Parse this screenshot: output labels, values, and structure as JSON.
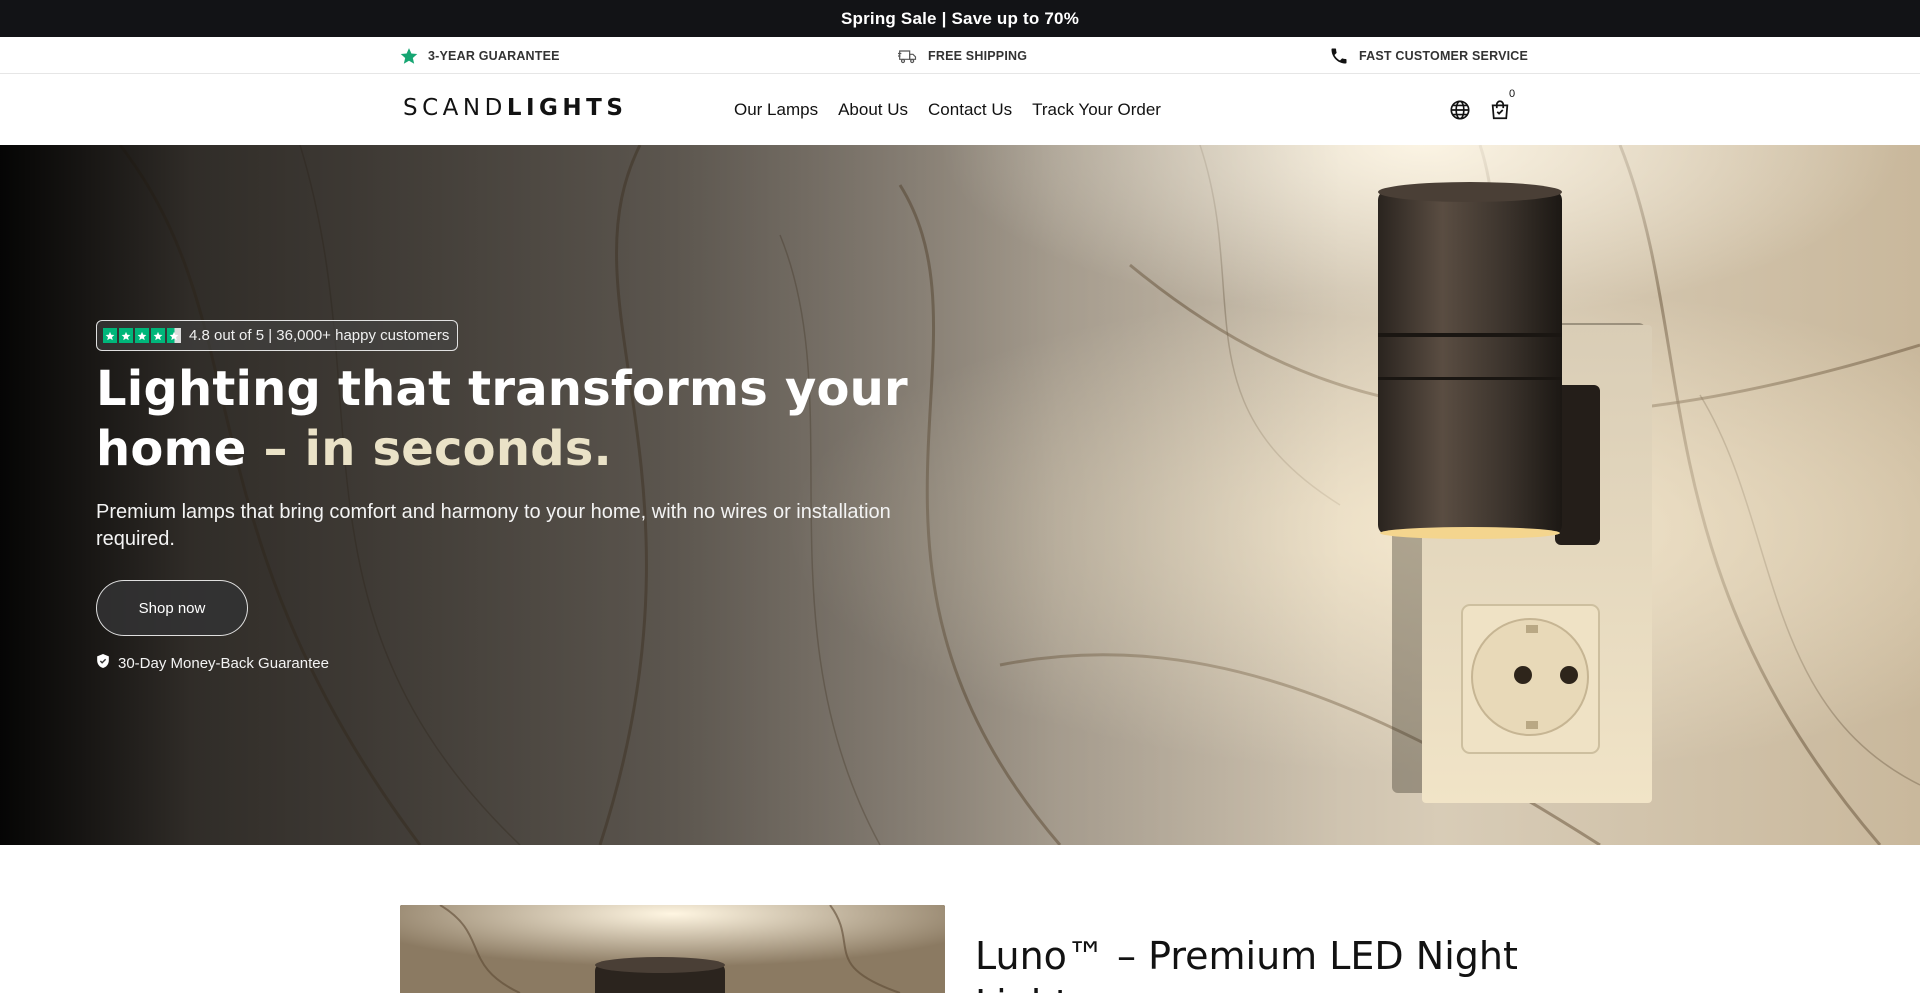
{
  "announcement": {
    "text": "Spring Sale | Save up to 70%"
  },
  "usp": {
    "items": [
      {
        "icon": "star-icon",
        "label": "3-YEAR GUARANTEE"
      },
      {
        "icon": "truck-icon",
        "label": "FREE SHIPPING"
      },
      {
        "icon": "phone-icon",
        "label": "FAST CUSTOMER SERVICE"
      }
    ]
  },
  "header": {
    "logo_light": "SCAND",
    "logo_bold": "LIGHTS",
    "nav": [
      {
        "label": "Our Lamps"
      },
      {
        "label": "About Us"
      },
      {
        "label": "Contact Us"
      },
      {
        "label": "Track Your Order"
      }
    ],
    "icons": [
      "globe-icon",
      "cart-icon"
    ],
    "cart_count": "0"
  },
  "hero": {
    "rating_text": "4.8 out of 5 | 36,000+ happy customers",
    "rating_value": 4.8,
    "headline_main": "Lighting that transforms your home",
    "headline_accent": " – in seconds.",
    "subtext": "Premium lamps that bring comfort and harmony to your home, with no wires or installation required.",
    "cta_label": "Shop now",
    "guarantee_text": "30-Day Money-Back Guarantee"
  },
  "product": {
    "title": "Luno™ – Premium LED Night Light"
  },
  "colors": {
    "announce_bg": "#121316",
    "rating_green": "#00b67a",
    "headline_accent": "#eae2c7"
  }
}
